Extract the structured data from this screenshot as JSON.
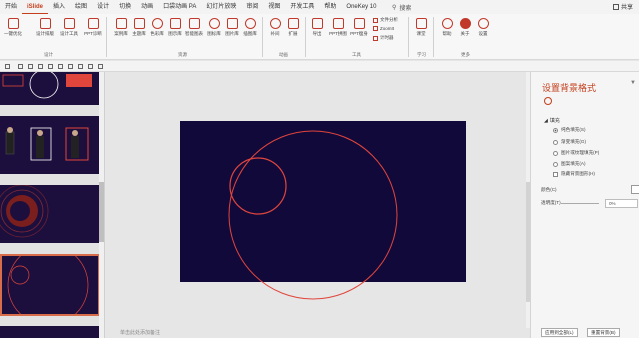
{
  "menubar": {
    "tabs": [
      {
        "label": "开始"
      },
      {
        "label": "iSlide",
        "active": true
      },
      {
        "label": "插入"
      },
      {
        "label": "绘图"
      },
      {
        "label": "设计"
      },
      {
        "label": "切换"
      },
      {
        "label": "动画"
      },
      {
        "label": "口袋动画 PA"
      },
      {
        "label": "幻灯片放映"
      },
      {
        "label": "审阅"
      },
      {
        "label": "视图"
      },
      {
        "label": "开发工具"
      },
      {
        "label": "帮助"
      },
      {
        "label": "OneKey 10"
      }
    ],
    "search_label": "搜索",
    "share_label": "共享"
  },
  "ribbon": {
    "buttons": [
      "一键优化",
      "设计排版",
      "设计工具",
      "PPT诊断",
      "案例库",
      "主题库",
      "色彩库",
      "图示库",
      "智能图表",
      "图标库",
      "图片库",
      "插图库",
      "补间",
      "扩展",
      "导出",
      "PPT拼图",
      "PPT瘦身",
      "课堂",
      "帮助",
      "关于",
      "设置"
    ],
    "small_buttons": [
      "文件分析",
      "ZoomIt",
      "计时器"
    ],
    "groups": [
      "设计",
      "资源",
      "动画",
      "工具",
      "学习",
      "更多"
    ]
  },
  "pane": {
    "title": "设置背景格式",
    "section": "填充",
    "options": [
      {
        "label": "纯色填充(S)",
        "selected": true
      },
      {
        "label": "渐变填充(G)",
        "selected": false
      },
      {
        "label": "图片或纹理填充(P)",
        "selected": false
      },
      {
        "label": "图案填充(A)",
        "selected": false
      }
    ],
    "hide_bg": "隐藏背景图形(H)",
    "color_label": "颜色(C)",
    "transparency_label": "透明度(T)",
    "transparency_value": "0%",
    "apply_all": "应用到全部(L)",
    "reset": "重置背景(B)"
  },
  "status": {
    "notes_placeholder": "单击此处添加备注"
  },
  "colors": {
    "accent": "#c43e1c",
    "slide_bg": "#12093b",
    "circle": "#e0463c"
  }
}
